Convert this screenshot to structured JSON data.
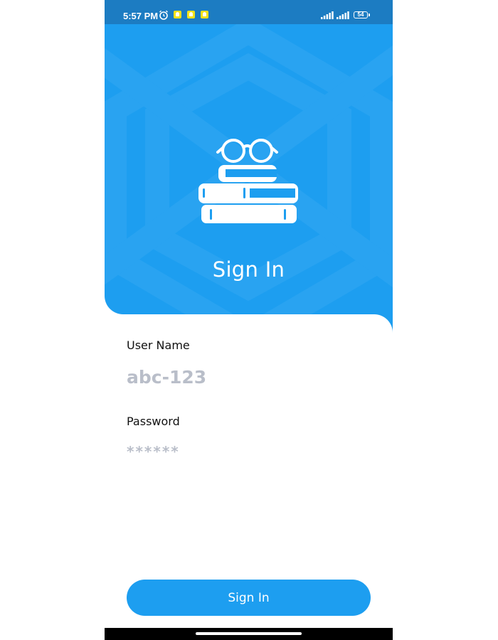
{
  "status_bar": {
    "time": "5:57 PM",
    "battery": "54",
    "icons": [
      "alarm-icon",
      "snapchat-icon",
      "snapchat-icon",
      "snapchat-icon",
      "signal-icon",
      "signal-icon",
      "battery-icon"
    ]
  },
  "header": {
    "title": "Sign In",
    "logo_icon": "books-glasses-icon",
    "background_color": "#1d9ef0"
  },
  "form": {
    "username_label": "User Name",
    "username_placeholder": "abc-123",
    "password_label": "Password",
    "password_placeholder": "******"
  },
  "actions": {
    "signin_label": "Sign In",
    "button_color": "#1d9ef0"
  }
}
